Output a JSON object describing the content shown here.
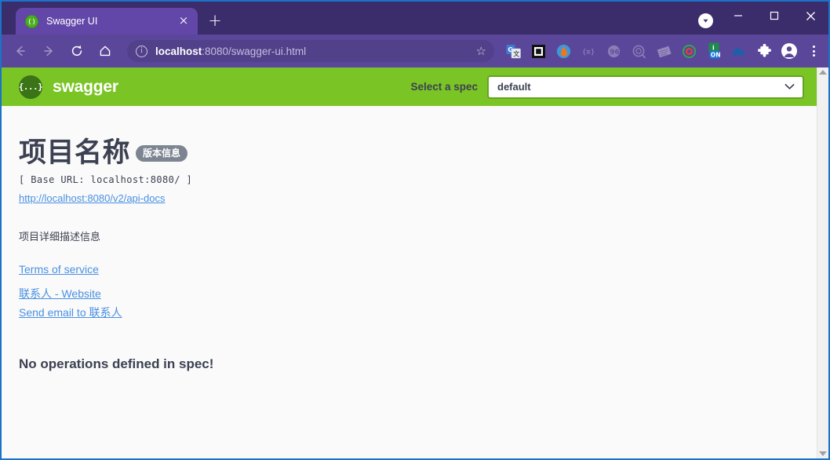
{
  "browser": {
    "tab": {
      "title": "Swagger UI",
      "favicon_icon": "swagger-favicon-icon",
      "close_icon": "×"
    },
    "new_tab_icon": "+",
    "window_controls": {
      "profile_icon": "caret-down-circle-icon",
      "minimize": "—",
      "maximize": "□",
      "close": "✕"
    },
    "nav": {
      "back_icon": "back-arrow-icon",
      "forward_icon": "forward-arrow-icon",
      "reload_icon": "reload-icon",
      "home_icon": "home-icon"
    },
    "omnibox": {
      "info_icon": "ⓘ",
      "url_host": "localhost",
      "url_path": ":8080/swagger-ui.html",
      "full_url": "localhost:8080/swagger-ui.html",
      "bookmark_icon": "☆"
    },
    "extensions": [
      {
        "name": "google-translate-extension-icon"
      },
      {
        "name": "picture-in-picture-extension-icon"
      },
      {
        "name": "firefox-send-extension-icon"
      },
      {
        "name": "json-formatter-extension-icon"
      },
      {
        "name": "grammar-extension-icon"
      },
      {
        "name": "search-history-extension-icon"
      },
      {
        "name": "notes-extension-icon"
      },
      {
        "name": "sync-extension-icon"
      },
      {
        "name": "privacy-on-extension-icon"
      },
      {
        "name": "onedrive-extension-icon"
      },
      {
        "name": "puzzle-extensions-icon"
      },
      {
        "name": "profile-avatar-icon"
      }
    ],
    "menu_icon": "kebab-menu-icon"
  },
  "swagger": {
    "topbar": {
      "logo_mark": "{...}",
      "wordmark": "swagger",
      "spec_label": "Select a spec",
      "select_value": "default",
      "select_caret": "chevron-down-icon"
    },
    "info": {
      "title": "项目名称",
      "version_badge": "版本信息",
      "base_url": "[ Base URL: localhost:8080/ ]",
      "api_docs_link": "http://localhost:8080/v2/api-docs",
      "description": "项目详细描述信息",
      "terms_link": "Terms of service",
      "contact_website_link": "联系人 - Website",
      "contact_email_link": "Send email to 联系人"
    },
    "no_operations": "No operations defined in spec!"
  },
  "colors": {
    "swagger_green": "#7bc425",
    "swagger_dark_green": "#3b7317",
    "text_dark": "#3b4151",
    "link_blue": "#4990e2",
    "badge_gray": "#7d8492",
    "browser_purple": "#5b4799",
    "window_border_blue": "#1a73c8"
  },
  "scrollbar": {
    "up_arrow_icon": "scroll-up-arrow-icon",
    "down_arrow_icon": "scroll-down-arrow-icon"
  }
}
